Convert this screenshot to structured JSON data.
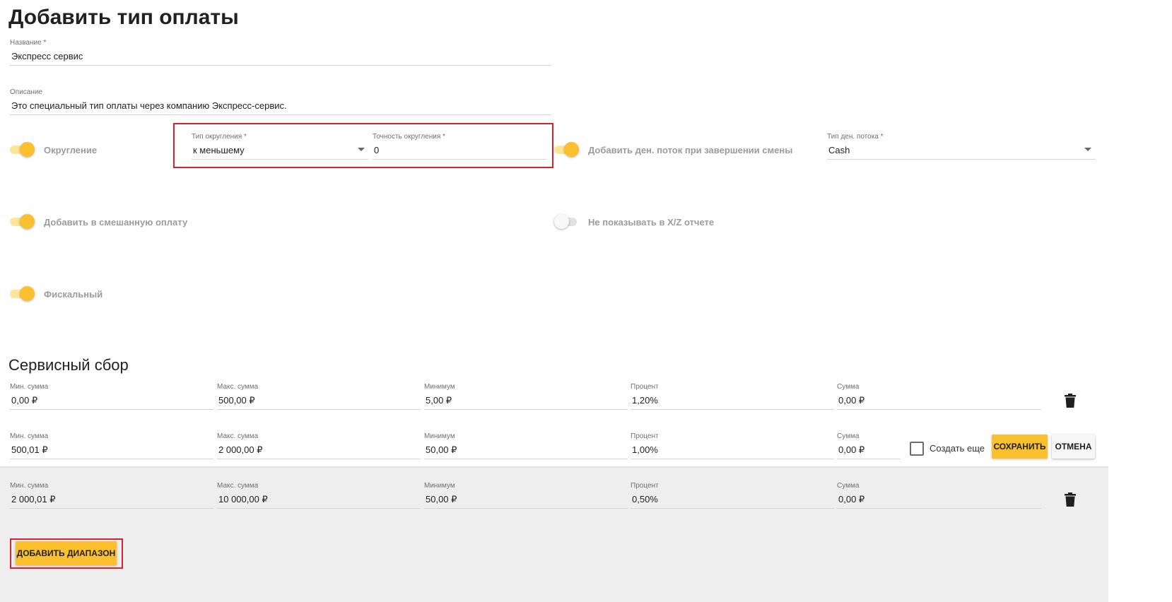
{
  "page": {
    "title": "Добавить тип оплаты"
  },
  "form": {
    "name": {
      "label": "Название *",
      "value": "Экспресс сервис"
    },
    "description": {
      "label": "Описание",
      "value": "Это специальный тип оплаты через компанию Экспресс-сервис."
    },
    "rounding": {
      "label": "Округление",
      "enabled": true
    },
    "rounding_type": {
      "label": "Тип округления *",
      "value": "к меньшему"
    },
    "rounding_precision": {
      "label": "Точность округления *",
      "value": "0"
    },
    "add_cash_flow": {
      "label": "Добавить ден. поток при завершении смены",
      "enabled": true
    },
    "cash_flow_type": {
      "label": "Тип ден. потока *",
      "value": "Cash"
    },
    "mixed_payment": {
      "label": "Добавить в смешанную оплату",
      "enabled": true
    },
    "hide_xz": {
      "label": "Не показывать в X/Z отчете",
      "enabled": false
    },
    "fiscal": {
      "label": "Фискальный",
      "enabled": true
    }
  },
  "service_fee": {
    "title": "Сервисный сбор",
    "column_labels": [
      "Мин. сумма",
      "Макс. сумма",
      "Минимум",
      "Процент",
      "Сумма"
    ],
    "rows": [
      {
        "min": "0,00 ₽",
        "max": "500,00 ₽",
        "minimum": "5,00 ₽",
        "percent": "1,20%",
        "sum": "0,00 ₽"
      },
      {
        "min": "500,01 ₽",
        "max": "2 000,00 ₽",
        "minimum": "50,00 ₽",
        "percent": "1,00%",
        "sum": "0,00 ₽"
      },
      {
        "min": "2 000,01 ₽",
        "max": "10 000,00 ₽",
        "minimum": "50,00 ₽",
        "percent": "0,50%",
        "sum": "0,00 ₽"
      }
    ],
    "create_more_label": "Создать еще",
    "save_label": "СОХРАНИТЬ",
    "cancel_label": "ОТМЕНА",
    "add_range_label": "ДОБАВИТЬ ДИАПАЗОН"
  },
  "colors": {
    "accent": "#fbc02d",
    "highlight": "#d92231"
  },
  "icons": {
    "delete": "trash-icon",
    "dropdown": "caret-down-icon"
  }
}
